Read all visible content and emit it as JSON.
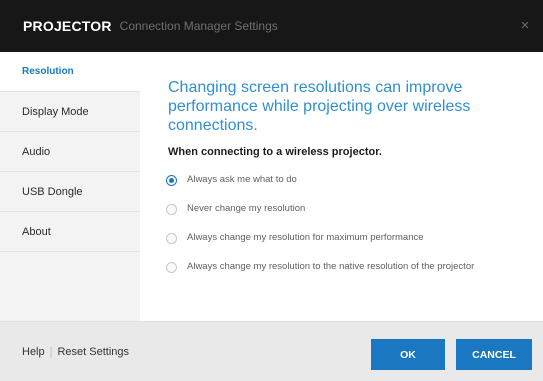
{
  "titlebar": {
    "brand": "PROJECTOR",
    "subtitle": "Connection Manager Settings",
    "close_symbol": "×"
  },
  "sidebar": {
    "items": [
      {
        "label": "Resolution",
        "active": true
      },
      {
        "label": "Display Mode",
        "active": false
      },
      {
        "label": "Audio",
        "active": false
      },
      {
        "label": "USB Dongle",
        "active": false
      },
      {
        "label": "About",
        "active": false
      }
    ]
  },
  "main": {
    "headline": "Changing screen resolutions can improve performance while projecting over wireless connections.",
    "subheading": "When connecting to a wireless projector.",
    "options": [
      {
        "label": "Always ask me what to do",
        "selected": true
      },
      {
        "label": "Never change my resolution",
        "selected": false
      },
      {
        "label": "Always change my resolution for maximum performance",
        "selected": false
      },
      {
        "label": "Always change my resolution to the native resolution of the projector",
        "selected": false
      }
    ]
  },
  "footer": {
    "help_label": "Help",
    "reset_label": "Reset Settings",
    "ok_label": "OK",
    "cancel_label": "CANCEL"
  },
  "colors": {
    "accent": "#1a78c2",
    "headline": "#2f8fd1",
    "titlebar_bg": "#171717"
  }
}
